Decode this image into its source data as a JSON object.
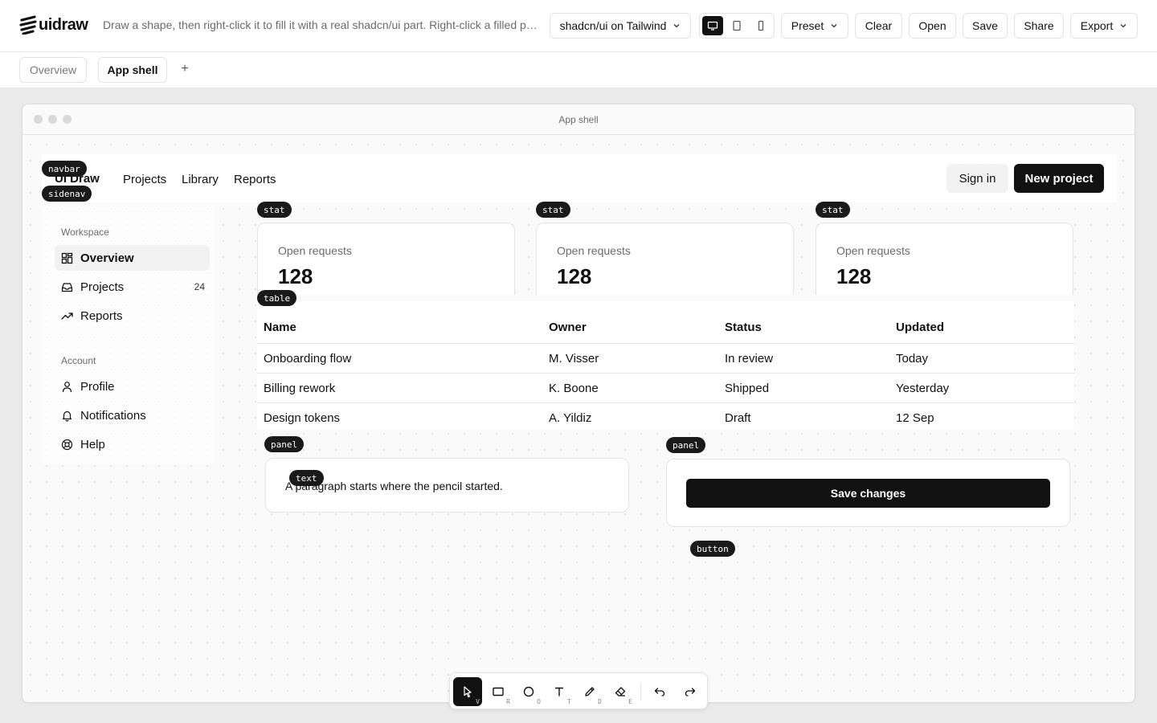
{
  "app": {
    "name": "uidraw",
    "tagline": "Draw a shape, then right-click it to fill it with a real shadcn/ui part. Right-click a filled part to change it."
  },
  "toolbar": {
    "framework_select": "shadcn/ui on Tailwind",
    "devices": [
      "desktop-icon",
      "tablet-icon",
      "phone-icon"
    ],
    "active_device": "desktop",
    "preset_label": "Preset",
    "clear_label": "Clear",
    "open_label": "Open",
    "save_label": "Save",
    "share_label": "Share",
    "export_label": "Export"
  },
  "pages": {
    "tabs": [
      {
        "label": "Overview",
        "active": false
      },
      {
        "label": "App shell",
        "active": true
      }
    ],
    "add_label": "+"
  },
  "canvas": {
    "window_title": "App shell",
    "tags": {
      "navbar": "navbar",
      "sidenav": "sidenav",
      "stat": "stat",
      "table": "table",
      "panel": "panel",
      "text": "text",
      "button": "button"
    },
    "navbar": {
      "brand": "UI Draw",
      "links": [
        "Projects",
        "Library",
        "Reports"
      ],
      "sign_in": "Sign in",
      "new_project": "New project"
    },
    "sidenav": {
      "groups": [
        {
          "title": "Workspace",
          "items": [
            {
              "label": "Overview",
              "icon": "grid-icon",
              "active": true,
              "count": ""
            },
            {
              "label": "Projects",
              "icon": "inbox-icon",
              "active": false,
              "count": "24"
            },
            {
              "label": "Reports",
              "icon": "trending-up-icon",
              "active": false,
              "count": ""
            }
          ]
        },
        {
          "title": "Account",
          "items": [
            {
              "label": "Profile",
              "icon": "user-icon",
              "active": false,
              "count": ""
            },
            {
              "label": "Notifications",
              "icon": "bell-icon",
              "active": false,
              "count": ""
            },
            {
              "label": "Help",
              "icon": "life-buoy-icon",
              "active": false,
              "count": ""
            }
          ]
        }
      ]
    },
    "stats": [
      {
        "label": "Open requests",
        "value": "128"
      },
      {
        "label": "Open requests",
        "value": "128"
      },
      {
        "label": "Open requests",
        "value": "128"
      }
    ],
    "table": {
      "columns": [
        "Name",
        "Owner",
        "Status",
        "Updated"
      ],
      "rows": [
        [
          "Onboarding flow",
          "M. Visser",
          "In review",
          "Today"
        ],
        [
          "Billing rework",
          "K. Boone",
          "Shipped",
          "Yesterday"
        ],
        [
          "Design tokens",
          "A. Yildiz",
          "Draft",
          "12 Sep"
        ]
      ]
    },
    "panel_text": "A paragraph starts where the pencil started.",
    "save_changes": "Save changes"
  },
  "tools": [
    {
      "name": "select",
      "icon": "cursor-icon",
      "key": "V",
      "active": true
    },
    {
      "name": "rectangle",
      "icon": "rectangle-icon",
      "key": "R",
      "active": false
    },
    {
      "name": "ellipse",
      "icon": "circle-icon",
      "key": "O",
      "active": false
    },
    {
      "name": "text",
      "icon": "text-icon",
      "key": "T",
      "active": false
    },
    {
      "name": "draw",
      "icon": "pencil-icon",
      "key": "D",
      "active": false
    },
    {
      "name": "eraser",
      "icon": "eraser-icon",
      "key": "E",
      "active": false
    }
  ],
  "history": {
    "undo_icon": "undo-icon",
    "redo_icon": "redo-icon"
  }
}
